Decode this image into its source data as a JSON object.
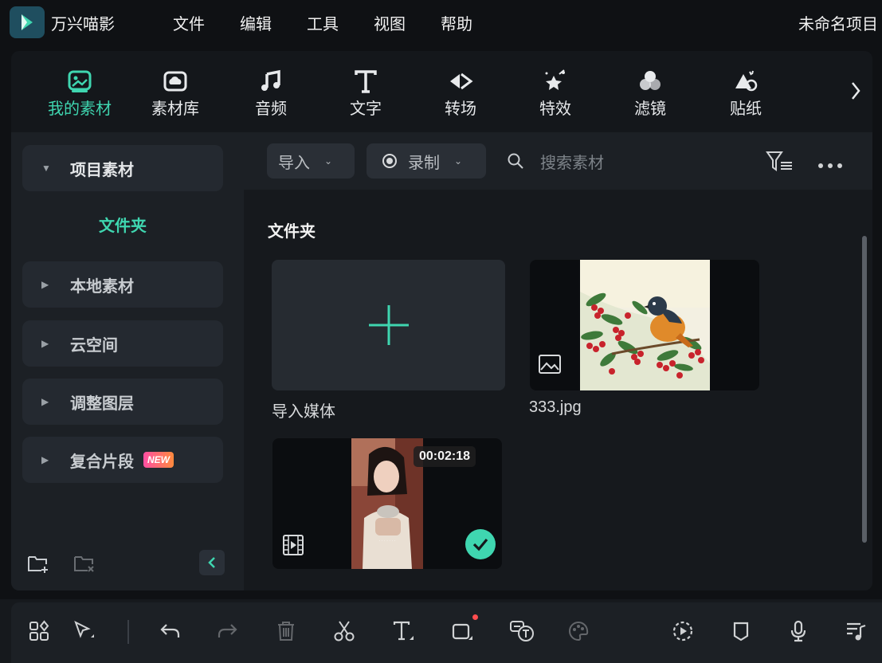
{
  "app": {
    "name": "万兴喵影",
    "project_title": "未命名项目"
  },
  "menu": [
    "文件",
    "编辑",
    "工具",
    "视图",
    "帮助"
  ],
  "tabs": [
    {
      "label": "我的素材",
      "icon": "my-media-icon",
      "active": true
    },
    {
      "label": "素材库",
      "icon": "cloud-library-icon",
      "active": false
    },
    {
      "label": "音频",
      "icon": "music-note-icon",
      "active": false
    },
    {
      "label": "文字",
      "icon": "text-t-icon",
      "active": false
    },
    {
      "label": "转场",
      "icon": "transition-icon",
      "active": false
    },
    {
      "label": "特效",
      "icon": "effects-icon",
      "active": false
    },
    {
      "label": "滤镜",
      "icon": "filter-circles-icon",
      "active": false
    },
    {
      "label": "贴纸",
      "icon": "sticker-icon",
      "active": false
    }
  ],
  "sidebar": {
    "items": [
      {
        "label": "项目素材",
        "expanded": true
      },
      {
        "label": "本地素材"
      },
      {
        "label": "云空间"
      },
      {
        "label": "调整图层"
      },
      {
        "label": "复合片段",
        "badge": "NEW"
      }
    ],
    "sub_item": "文件夹"
  },
  "filterbar": {
    "import_label": "导入",
    "record_label": "录制",
    "search_placeholder": "搜索素材"
  },
  "content": {
    "section_title": "文件夹",
    "import_card_label": "导入媒体",
    "media": [
      {
        "name": "333.jpg",
        "type": "image"
      },
      {
        "name": "",
        "type": "video",
        "duration": "00:02:18",
        "selected": true
      }
    ]
  },
  "colors": {
    "accent": "#3fd6b0",
    "badge_from": "#ff4fa3",
    "badge_to": "#ff8a3d"
  }
}
